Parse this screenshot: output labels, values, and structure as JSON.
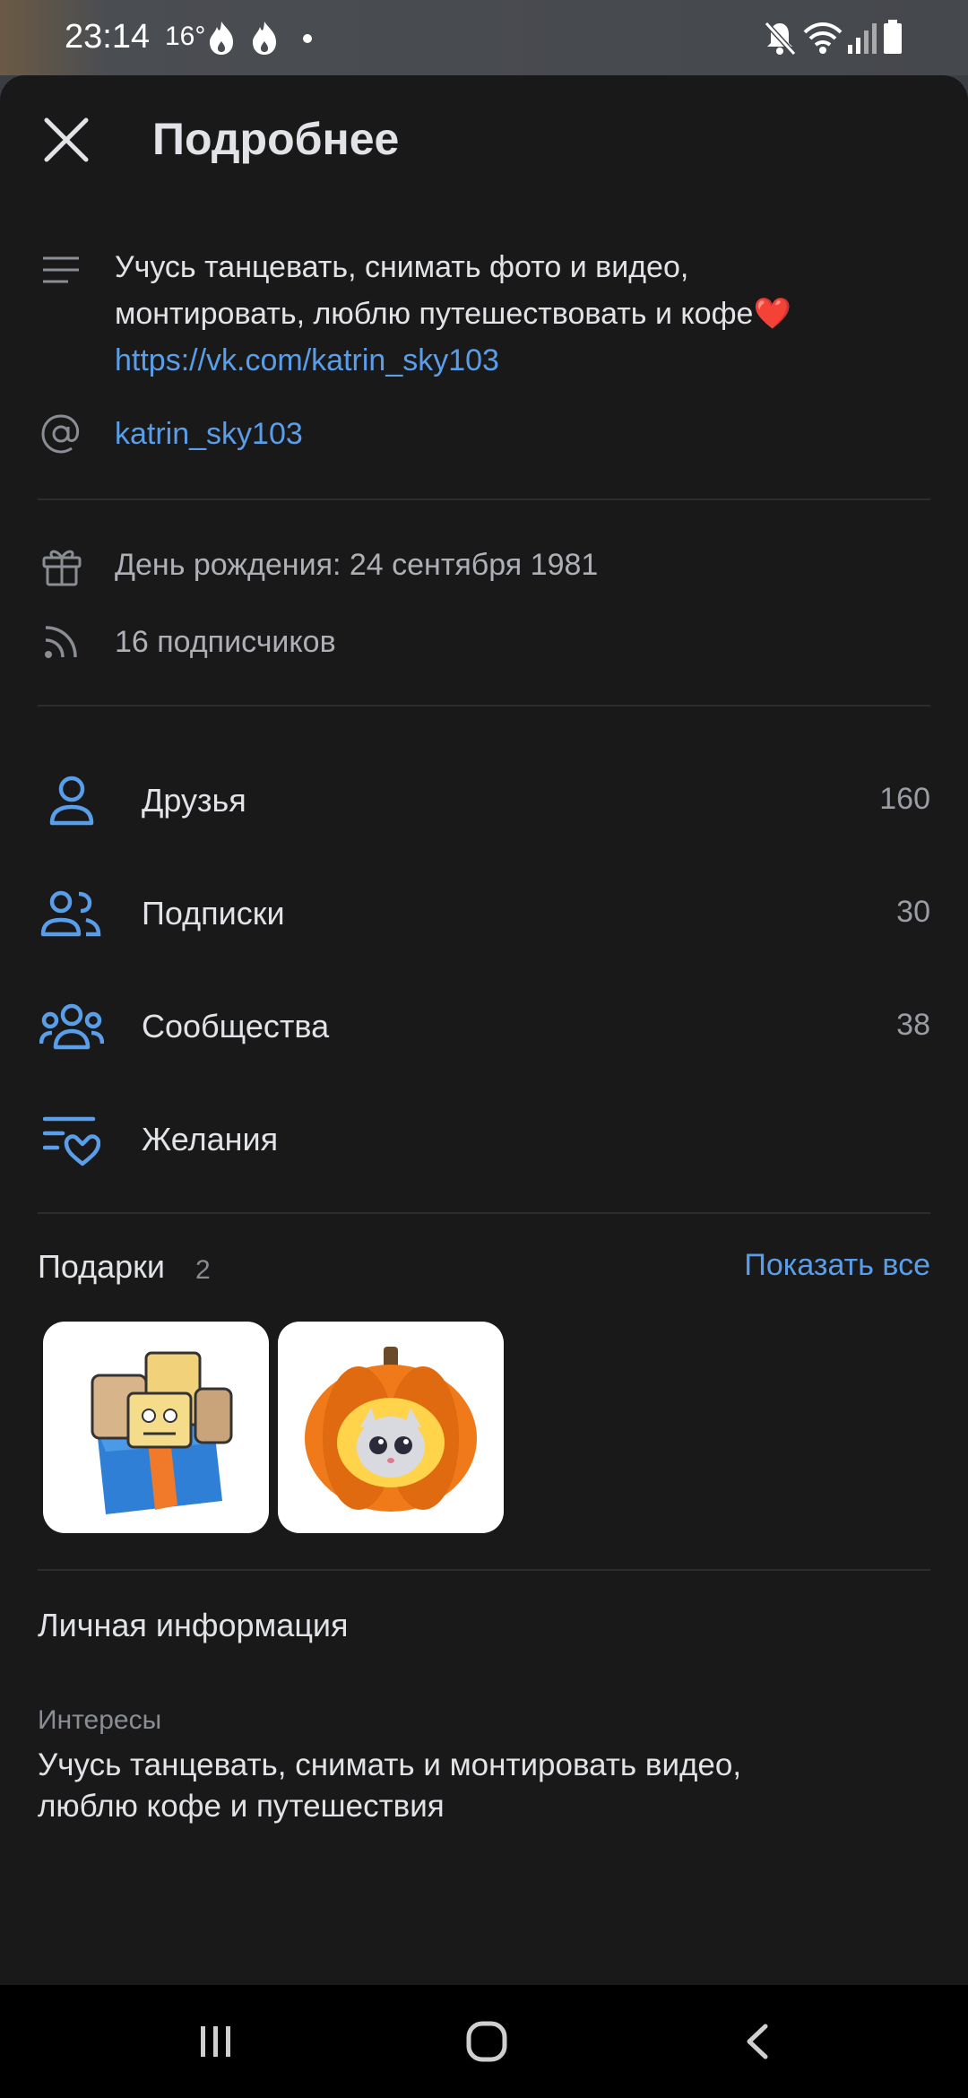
{
  "status_bar": {
    "time": "23:14",
    "temperature": "16°",
    "icons": [
      "fire-icon",
      "fire-icon",
      "dot-icon",
      "mute-icon",
      "wifi-icon",
      "signal-icon",
      "battery-icon"
    ]
  },
  "header": {
    "title": "Подробнее",
    "close_icon": "close-icon"
  },
  "about": {
    "status_line1": "Учусь танцевать, снимать фото и видео,",
    "status_line2": "монтировать, люблю путешествовать и кофе❤️",
    "link": "https://vk.com/katrin_sky103",
    "username": "katrin_sky103"
  },
  "info": {
    "birthday": "День рождения: 24 сентября 1981",
    "followers": "16 подписчиков"
  },
  "menu": [
    {
      "label": "Друзья",
      "count": "160",
      "icon": "person-icon"
    },
    {
      "label": "Подписки",
      "count": "30",
      "icon": "people-icon"
    },
    {
      "label": "Сообщества",
      "count": "38",
      "icon": "groups-icon"
    },
    {
      "label": "Желания",
      "count": "",
      "icon": "wishlist-heart-icon"
    }
  ],
  "gifts": {
    "title": "Подарки",
    "count": "2",
    "show_all": "Показать все",
    "items": [
      "gift-box-sticker",
      "pumpkin-cat-sticker"
    ]
  },
  "personal": {
    "title": "Личная информация",
    "interests_label": "Интересы",
    "interests_line1": "Учусь танцевать, снимать и монтировать видео,",
    "interests_line2": "люблю кофе и путешествия"
  },
  "colors": {
    "accent": "#5a9eea",
    "background": "#19191a",
    "text": "#e1e3e6",
    "muted": "#aeb0b5"
  }
}
